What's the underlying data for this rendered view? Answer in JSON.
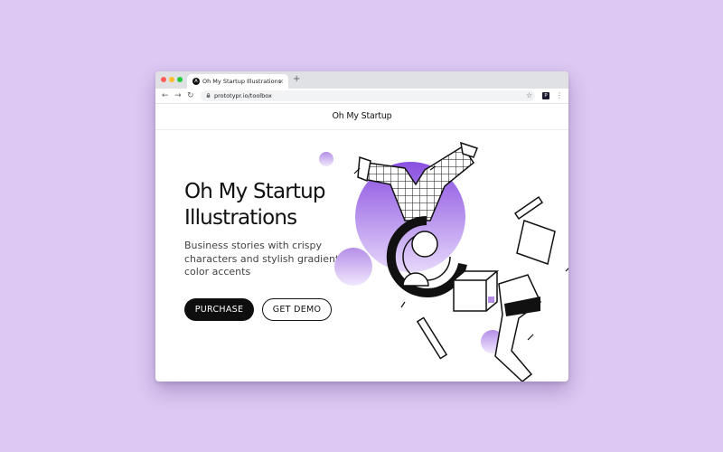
{
  "browser": {
    "tab_title": "Oh My Startup Illustrations",
    "tab_favicon": "A",
    "tab_close": "×",
    "new_tab": "+",
    "url": "prototypr.io/toolbox",
    "extension_label": "P",
    "icons": [
      "back-icon",
      "forward-icon",
      "reload-icon",
      "lock-icon",
      "star-icon",
      "menu-icon"
    ]
  },
  "site": {
    "logo": "Oh My Startup"
  },
  "hero": {
    "title_line1": "Oh My Startup",
    "title_line2": "Illustrations",
    "subtitle_line1": "Business stories with crispy",
    "subtitle_line2": "characters and stylish gradient",
    "subtitle_line3": "color accents",
    "purchase_label": "PURCHASE",
    "demo_label": "GET DEMO"
  },
  "colors": {
    "background": "#dcc8f2",
    "accent_purple": "#8a4fe0",
    "primary_button": "#0e0e0e"
  }
}
